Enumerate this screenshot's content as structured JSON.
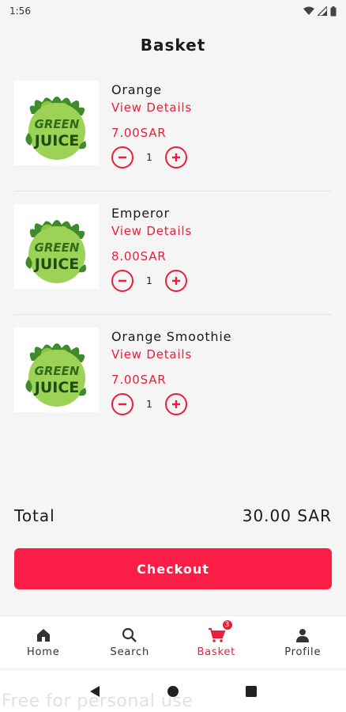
{
  "status_bar": {
    "time": "1:56",
    "icons": [
      "wifi-icon",
      "signal-icon",
      "battery-icon"
    ]
  },
  "header": {
    "title": "Basket"
  },
  "items": [
    {
      "name": "Orange",
      "details_label": "View Details",
      "price": "7.00SAR",
      "quantity": "1",
      "image": "green-juice-logo"
    },
    {
      "name": "Emperor",
      "details_label": "View Details",
      "price": "8.00SAR",
      "quantity": "1",
      "image": "green-juice-logo"
    },
    {
      "name": "Orange Smoothie",
      "details_label": "View Details",
      "price": "7.00SAR",
      "quantity": "1",
      "image": "green-juice-logo"
    }
  ],
  "logo_text": {
    "line1": "GREEN",
    "line2": "JUICE"
  },
  "summary": {
    "total_label": "Total",
    "total_value": "30.00 SAR"
  },
  "checkout": {
    "label": "Checkout"
  },
  "bottom_nav": {
    "items": [
      {
        "label": "Home",
        "icon": "home-icon",
        "active": false
      },
      {
        "label": "Search",
        "icon": "search-icon",
        "active": false
      },
      {
        "label": "Basket",
        "icon": "cart-icon",
        "active": true,
        "badge": "3"
      },
      {
        "label": "Profile",
        "icon": "profile-icon",
        "active": false
      }
    ]
  },
  "watermark": "Free for personal use",
  "colors": {
    "accent": "#e8203b",
    "button": "#fa1e47",
    "background": "#f5f5f5"
  }
}
